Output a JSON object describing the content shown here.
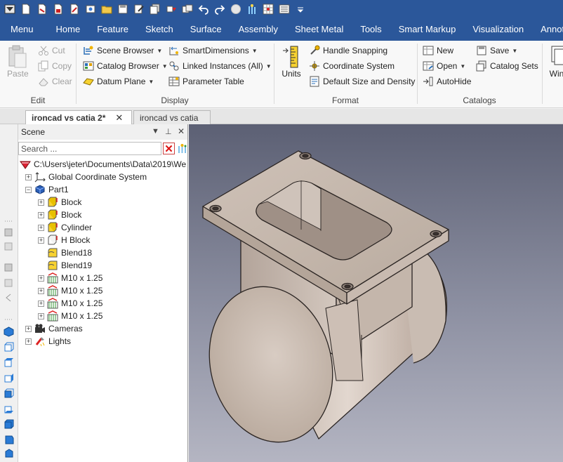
{
  "qat": {
    "icons": [
      "app-icon",
      "new-icon",
      "open-icon",
      "save-icon",
      "save-as-icon",
      "print-icon",
      "folder-icon",
      "disk-icon",
      "edit-icon",
      "pages-icon",
      "tools-icon",
      "copy-icon",
      "undo-icon",
      "redo-icon",
      "sphere-icon",
      "triball-icon",
      "grid-icon",
      "settings-icon",
      "qat-more-icon"
    ]
  },
  "menu": {
    "tabs": [
      "Menu",
      "Home",
      "Feature",
      "Sketch",
      "Surface",
      "Assembly",
      "Sheet Metal",
      "Tools",
      "Smart Markup",
      "Visualization",
      "Annota"
    ]
  },
  "ribbon": {
    "edit": {
      "label": "Edit",
      "paste": "Paste",
      "cut": "Cut",
      "copy": "Copy",
      "clear": "Clear"
    },
    "display": {
      "label": "Display",
      "scene_browser": "Scene Browser",
      "catalog_browser": "Catalog Browser",
      "datum_plane": "Datum Plane",
      "smart_dimensions": "SmartDimensions",
      "linked_instances": "Linked Instances (All)",
      "parameter_table": "Parameter Table"
    },
    "format": {
      "label": "Format",
      "units": "Units",
      "handle_snapping": "Handle Snapping",
      "coordinate_system": "Coordinate System",
      "default_size": "Default Size and Density"
    },
    "catalogs": {
      "label": "Catalogs",
      "new": "New",
      "open": "Open",
      "autohide": "AutoHide",
      "save": "Save",
      "catalog_sets": "Catalog Sets"
    },
    "window": {
      "label": "Win"
    }
  },
  "doctabs": [
    {
      "label": "ironcad vs catia 2*",
      "active": true,
      "close": "✕"
    },
    {
      "label": "ironcad vs catia",
      "active": false
    }
  ],
  "scene": {
    "title": "Scene",
    "search_placeholder": "Search ...",
    "tree": [
      {
        "label": "C:\\Users\\jeter\\Documents\\Data\\2019\\We",
        "icon": "scene-root-icon",
        "expander": "",
        "level": 0
      },
      {
        "label": "Global Coordinate System",
        "icon": "coordinate-system-icon",
        "expander": "+",
        "level": 0
      },
      {
        "label": "Part1",
        "icon": "part-icon",
        "expander": "−",
        "level": 0
      },
      {
        "label": "Block",
        "icon": "block-icon",
        "expander": "+",
        "level": 1
      },
      {
        "label": "Block",
        "icon": "block-icon",
        "expander": "+",
        "level": 1
      },
      {
        "label": "Cylinder",
        "icon": "cylinder-icon",
        "expander": "+",
        "level": 1
      },
      {
        "label": "H Block",
        "icon": "hblock-icon",
        "expander": "+",
        "level": 1
      },
      {
        "label": "Blend18",
        "icon": "blend-icon",
        "expander": "",
        "level": 1
      },
      {
        "label": "Blend19",
        "icon": "blend-icon",
        "expander": "",
        "level": 1
      },
      {
        "label": "M10 x 1.25",
        "icon": "thread-hole-icon",
        "expander": "+",
        "level": 1
      },
      {
        "label": "M10 x 1.25",
        "icon": "thread-hole-icon",
        "expander": "+",
        "level": 1
      },
      {
        "label": "M10 x 1.25",
        "icon": "thread-hole-icon",
        "expander": "+",
        "level": 1
      },
      {
        "label": "M10 x 1.25",
        "icon": "thread-hole-icon",
        "expander": "+",
        "level": 1
      },
      {
        "label": "Cameras",
        "icon": "camera-icon",
        "expander": "+",
        "level": 0
      },
      {
        "label": "Lights",
        "icon": "light-icon",
        "expander": "+",
        "level": 0
      }
    ]
  },
  "colors": {
    "title_bar": "#2b579a",
    "model_face": "#cdbfb5",
    "model_dark": "#a8988c",
    "model_edge": "#2a2422"
  }
}
